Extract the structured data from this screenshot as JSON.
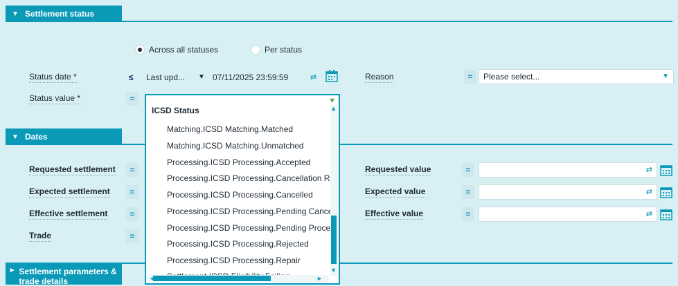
{
  "sections": {
    "settlement_status": "Settlement status",
    "dates": "Dates",
    "params": "Settlement parameters & trade details"
  },
  "radio": {
    "across": "Across all statuses",
    "per": "Per status"
  },
  "status_date": {
    "label": "Status date *",
    "op": "≤",
    "select": "Last upd...",
    "value": "07/11/2025 23:59:59"
  },
  "reason": {
    "label": "Reason",
    "op": "=",
    "placeholder": "Please select..."
  },
  "status_value": {
    "label": "Status value *",
    "op": "="
  },
  "dropdown": {
    "header": "ICSD Status",
    "items": [
      "Matching.ICSD Matching.Matched",
      "Matching.ICSD Matching.Unmatched",
      "Processing.ICSD Processing.Accepted",
      "Processing.ICSD Processing.Cancellation Req",
      "Processing.ICSD Processing.Cancelled",
      "Processing.ICSD Processing.Pending Cancella",
      "Processing.ICSD Processing.Pending Process",
      "Processing.ICSD Processing.Rejected",
      "Processing.ICSD Processing.Repair",
      "Settlement.ICSD Eligibility.Failing"
    ]
  },
  "dates": {
    "requested_settlement": "Requested settlement",
    "expected_settlement": "Expected settlement",
    "effective_settlement": "Effective settlement",
    "trade": "Trade",
    "requested_value": "Requested value",
    "expected_value": "Expected value",
    "effective_value": "Effective value",
    "op": "="
  },
  "icons": {
    "triangle_down": "▼",
    "triangle_right": "►",
    "swap": "⇄",
    "calendar": "calendar-icon"
  },
  "colors": {
    "accent": "#0a9ab8",
    "panel": "#dcf1f5"
  }
}
